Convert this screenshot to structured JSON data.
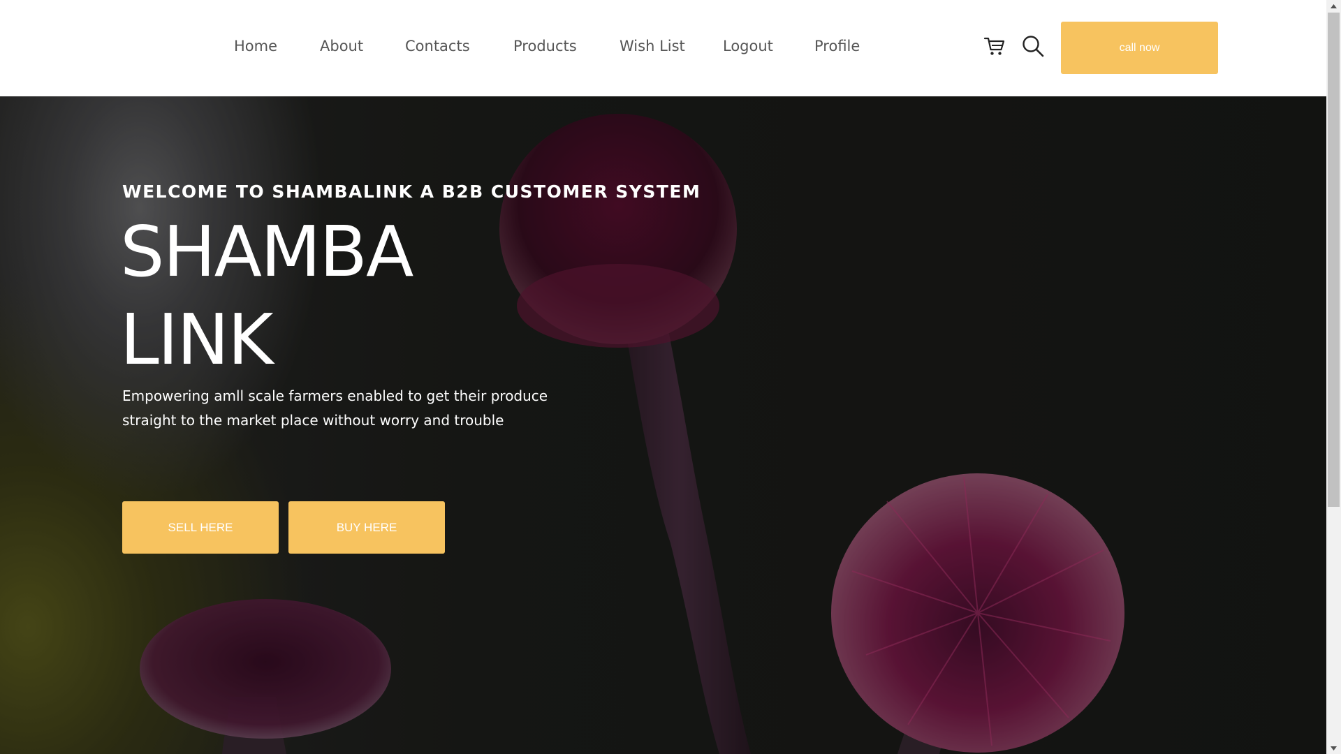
{
  "nav": {
    "items": [
      {
        "label": "Home"
      },
      {
        "label": "About"
      },
      {
        "label": "Contacts"
      },
      {
        "label": "Products"
      },
      {
        "label": "Wish List"
      },
      {
        "label": "Logout"
      },
      {
        "label": "Profile"
      }
    ],
    "cart_icon": "cart-icon",
    "search_icon": "search-icon",
    "call_label": "call now"
  },
  "hero": {
    "kicker": "WELCOME TO SHAMBALINK A B2B CUSTOMER SYSTEM",
    "title_line1": "SHAMBA",
    "title_line2": "LINK",
    "description": "Empowering amll scale farmers enabled to get their produce straight to the market place without worry and trouble",
    "sell_label": "SELL HERE",
    "buy_label": "BUY HERE"
  },
  "colors": {
    "accent": "#f7c35f",
    "nav_text": "#555555",
    "hero_text": "#ffffff"
  }
}
